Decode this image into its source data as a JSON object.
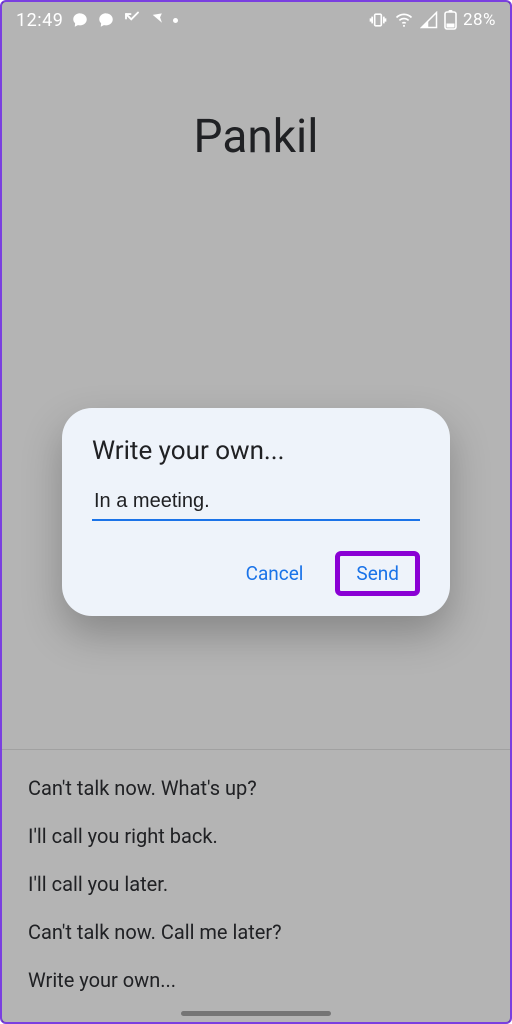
{
  "statusbar": {
    "time": "12:49",
    "battery_text": "28%"
  },
  "contact_name": "Pankil",
  "dialog": {
    "title": "Write your own...",
    "input_value": "In a meeting.",
    "cancel_label": "Cancel",
    "send_label": "Send"
  },
  "quick_replies": [
    "Can't talk now. What's up?",
    "I'll call you right back.",
    "I'll call you later.",
    "Can't talk now. Call me later?",
    "Write your own..."
  ],
  "colors": {
    "accent": "#1a73e8",
    "highlight": "#8a00d4",
    "dialog_bg": "#eef3fa"
  }
}
